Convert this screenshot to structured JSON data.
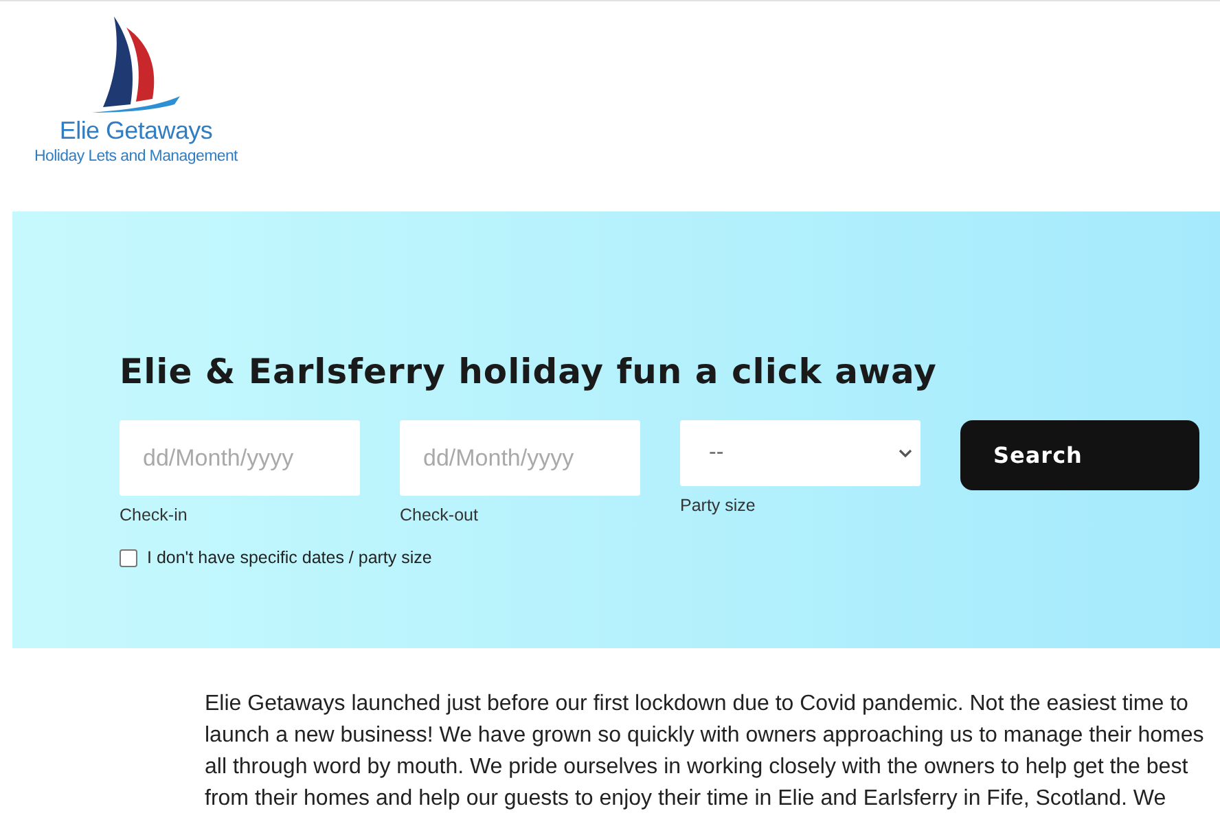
{
  "logo": {
    "name": "Elie Getaways",
    "tagline": "Holiday Lets and Management"
  },
  "hero": {
    "heading": "Elie & Earlsferry holiday fun a click away",
    "fields": [
      {
        "kind": "date",
        "placeholder": "dd/Month/yyyy",
        "label": "Check-in"
      },
      {
        "kind": "date",
        "placeholder": "dd/Month/yyyy",
        "label": "Check-out"
      },
      {
        "kind": "select",
        "value": "--",
        "label": "Party size"
      }
    ],
    "search_button": "Search",
    "flexible": {
      "label": "I don't have specific dates / party size",
      "checked": false
    }
  },
  "intro": "Elie Getaways launched just before our first lockdown due to Covid pandemic. Not the easiest time to launch a new business! We have grown so quickly with owners approaching us to manage their homes all through word by mouth. We pride ourselves in working closely with the owners to help get the best from their homes and help our guests to enjoy their time in Elie and Earlsferry in Fife, Scotland. We"
}
